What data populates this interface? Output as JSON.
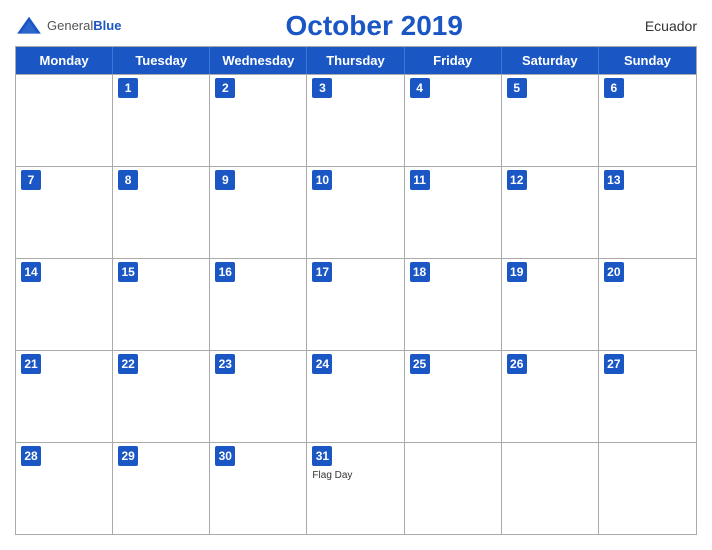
{
  "header": {
    "logo_general": "General",
    "logo_blue": "Blue",
    "title": "October 2019",
    "country": "Ecuador"
  },
  "day_headers": [
    "Monday",
    "Tuesday",
    "Wednesday",
    "Thursday",
    "Friday",
    "Saturday",
    "Sunday"
  ],
  "weeks": [
    [
      {
        "number": "",
        "empty": true
      },
      {
        "number": "1"
      },
      {
        "number": "2"
      },
      {
        "number": "3"
      },
      {
        "number": "4"
      },
      {
        "number": "5"
      },
      {
        "number": "6"
      }
    ],
    [
      {
        "number": "7"
      },
      {
        "number": "8"
      },
      {
        "number": "9"
      },
      {
        "number": "10"
      },
      {
        "number": "11"
      },
      {
        "number": "12"
      },
      {
        "number": "13"
      }
    ],
    [
      {
        "number": "14"
      },
      {
        "number": "15"
      },
      {
        "number": "16"
      },
      {
        "number": "17"
      },
      {
        "number": "18"
      },
      {
        "number": "19"
      },
      {
        "number": "20"
      }
    ],
    [
      {
        "number": "21"
      },
      {
        "number": "22"
      },
      {
        "number": "23"
      },
      {
        "number": "24"
      },
      {
        "number": "25"
      },
      {
        "number": "26"
      },
      {
        "number": "27"
      }
    ],
    [
      {
        "number": "28"
      },
      {
        "number": "29"
      },
      {
        "number": "30"
      },
      {
        "number": "31",
        "event": "Flag Day"
      },
      {
        "number": ""
      },
      {
        "number": ""
      },
      {
        "number": ""
      }
    ]
  ],
  "colors": {
    "header_bg": "#1a56c4",
    "header_text": "#ffffff",
    "title_color": "#1a56c4"
  }
}
